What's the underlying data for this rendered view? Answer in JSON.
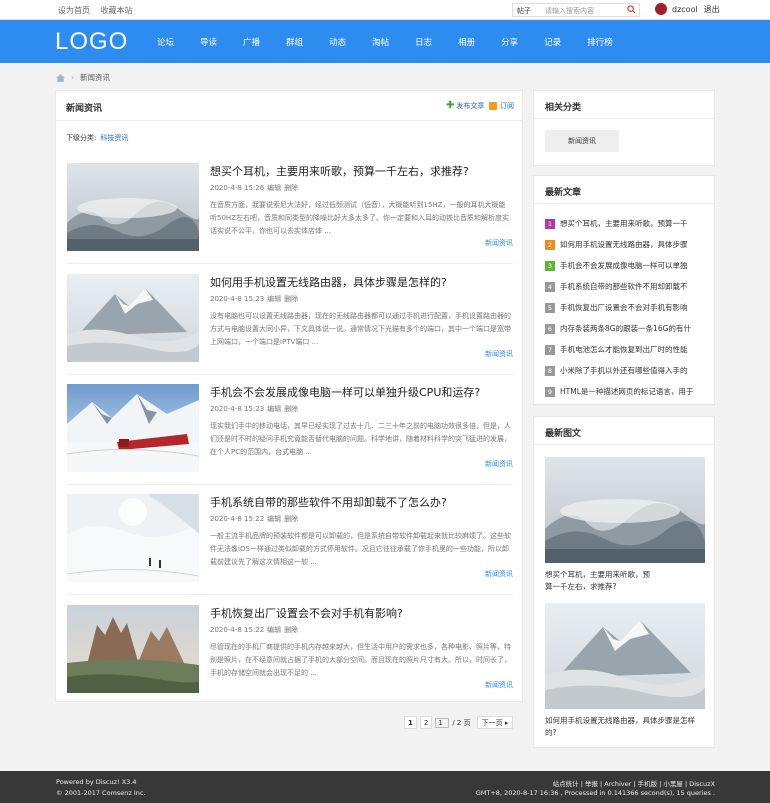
{
  "topbar": {
    "set_home": "设为首页",
    "bookmark": "收藏本站",
    "search_scope": "帖子",
    "search_placeholder": "请输入搜索内容",
    "username": "dzcool",
    "logout": "退出"
  },
  "nav": {
    "logo": "LOGO",
    "items": [
      "论坛",
      "导读",
      "广播",
      "群组",
      "动态",
      "淘帖",
      "日志",
      "相册",
      "分享",
      "记录",
      "排行榜"
    ]
  },
  "breadcrumb": {
    "current": "新闻资讯"
  },
  "main": {
    "title": "新闻资讯",
    "post_link": "发布文章",
    "subscribe_link": "订阅",
    "subcat_label": "下级分类:",
    "subcat_value": "科技资讯",
    "articles": [
      {
        "title": "想买个耳机，主要用来听歌，预算一千左右，求推荐?",
        "date": "2020-4-8 15:26",
        "edit": "编辑",
        "delete": "删除",
        "summary": "在音质方面，我要说索尼大法好，经过低频测试（低音），大概能听到15HZ，一般的耳机大概能听50HZ左右吧，音质和同类型的降噪比好大多太多了。你一定要和入耳的动铁比音质和解析度实话实说不公平，你也可以去实体店体 ...",
        "category": "新闻资讯",
        "thumb": "fog"
      },
      {
        "title": "如何用手机设置无线路由器，具体步骤是怎样的?",
        "date": "2020-4-8 15:23",
        "edit": "编辑",
        "delete": "删除",
        "summary": "没有电脑也可以设置无线路由器，现在的无线路由器都可以通过手机进行配置，手机设置路由器的方式与电脑设置大同小异，下文具体说一说。通常情况下光猫有多个的端口，其中一个端口是宽带上网端口，一个端口是IPTV端口 ...",
        "category": "新闻资讯",
        "thumb": "mountain"
      },
      {
        "title": "手机会不会发展成像电脑一样可以单独升级CPU和运存?",
        "date": "2020-4-8 15:23",
        "edit": "编辑",
        "delete": "删除",
        "summary": "现实我们手中的移动电话，其早已经实现了过去十几、二三十年之前的电脑功效很多倍，但是，人们还是时不时的疑问手机究竟能否替代电脑的问题。科学地讲，随着材料科学的突飞猛进的发展，在个人PC的范围内，台式电脑 ...",
        "category": "新闻资讯",
        "thumb": "train"
      },
      {
        "title": "手机系统自带的那些软件不用却卸载不了怎么办?",
        "date": "2020-4-8 15:22",
        "edit": "编辑",
        "delete": "删除",
        "summary": "一般主流手机品牌的预装软件都是可以卸载的，但是系统自带软件卸载起来就比较麻烦了。这些软件无法像iOS一样通过类似卸载的方式停用软件。况且它往往承载了你手机里的一些功能，所以卸载前建议先了解这次情相这一软 ...",
        "category": "新闻资讯",
        "thumb": "ski"
      },
      {
        "title": "手机恢复出厂设置会不会对手机有影响?",
        "date": "2020-4-8 15:22",
        "edit": "编辑",
        "delete": "删除",
        "summary": "尽管现在的手机厂商提供的手机内存越来越大，但生活中用户的需求也多，各种电影、照片等，特别是照片，在不经意间就占据了手机的大部分空间。而且现在的照片尺寸有大。所以，时间长了，手机的存储空间就会出现不足的 ...",
        "category": "新闻资讯",
        "thumb": "dolomites"
      }
    ],
    "pager": {
      "pages": [
        "1",
        "2"
      ],
      "input": "1",
      "total": "/ 2 页",
      "next": "下一页"
    }
  },
  "side": {
    "categories_title": "相关分类",
    "category_button": "新闻资讯",
    "latest_title": "最新文章",
    "latest": [
      {
        "n": "1",
        "t": "想买个耳机，主要用来听歌，预算一千",
        "c": "#b03aa4"
      },
      {
        "n": "2",
        "t": "如何用手机设置无线路由器，具体步骤",
        "c": "#f08a1c"
      },
      {
        "n": "3",
        "t": "手机会不会发展成像电脑一样可以单独",
        "c": "#5bb832"
      },
      {
        "n": "4",
        "t": "手机系统自带的那些软件不用却卸载不",
        "c": "#999999"
      },
      {
        "n": "5",
        "t": "手机恢复出厂设置会不会对手机有影响",
        "c": "#999999"
      },
      {
        "n": "6",
        "t": "内存条装两条8G的跟装一条16G的有什",
        "c": "#999999"
      },
      {
        "n": "7",
        "t": "手机电池怎么才能恢复到出厂时的性能",
        "c": "#999999"
      },
      {
        "n": "8",
        "t": "小米除了手机以外还有哪些值得入手的",
        "c": "#999999"
      },
      {
        "n": "9",
        "t": "HTML是一种描述网页的标记语言，用于",
        "c": "#999999"
      }
    ],
    "pics_title": "最新图文",
    "pics": [
      {
        "cap": "想买个耳机，主要用来听歌，预算一千左右，求推荐?",
        "thumb": "fog"
      },
      {
        "cap": "如何用手机设置无线路由器，具体步骤是怎样的?",
        "thumb": "mountain"
      }
    ]
  },
  "footer": {
    "powered": "Powered by Discuz! X3.4",
    "copyright": "© 2001-2017 Comsenz Inc.",
    "links": "站点统计 | 举报 | Archiver | 手机版 | 小黑屋 | DiscuzX",
    "stats": "GMT+8, 2020-8-17 16:36 , Processed in 0.141366 second(s), 15 queries ."
  }
}
